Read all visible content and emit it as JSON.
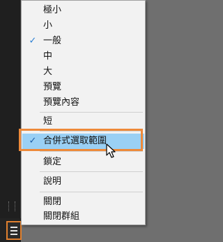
{
  "menu": {
    "items": [
      {
        "label": "極小",
        "checked": false
      },
      {
        "label": "小",
        "checked": false
      },
      {
        "label": "一般",
        "checked": true
      },
      {
        "label": "中",
        "checked": false
      },
      {
        "label": "大",
        "checked": false
      },
      {
        "label": "預覽",
        "checked": false
      },
      {
        "label": "預覽內容",
        "checked": false
      },
      {
        "label": "短",
        "checked": false
      },
      {
        "label": "合併式選取範圍",
        "checked": true,
        "highlighted": true
      },
      {
        "label": "鎖定",
        "checked": false
      },
      {
        "label": "說明",
        "checked": false
      },
      {
        "label": "關閉",
        "checked": false
      },
      {
        "label": "關閉群組",
        "checked": false
      }
    ],
    "check_glyph": "✓"
  },
  "icons": {
    "check": "checkmark-icon",
    "menu_button": "hamburger-menu-icon",
    "cursor": "mouse-pointer-icon"
  },
  "colors": {
    "accent_outline": "#ee8a3a",
    "highlight": "#9ad0f4",
    "check": "#2a7fd4"
  }
}
